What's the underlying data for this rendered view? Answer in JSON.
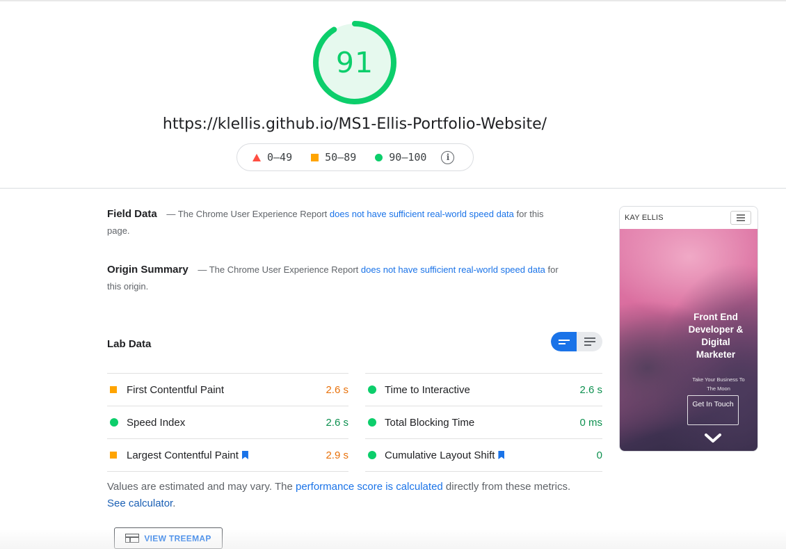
{
  "gauge": {
    "score": "91",
    "score_fraction": 0.91,
    "color": "#0cce6b"
  },
  "url": "https://klellis.github.io/MS1-Ellis-Portfolio-Website/",
  "legend": [
    {
      "icon": "triangle-icon",
      "label": "0–49",
      "color": "#ff4e42"
    },
    {
      "icon": "square-icon",
      "label": "50–89",
      "color": "#ffa400"
    },
    {
      "icon": "circle-icon",
      "label": "90–100",
      "color": "#0cce6b"
    }
  ],
  "field_data": {
    "title": "Field Data",
    "prefix": "— The Chrome User Experience Report",
    "link": "does not have sufficient real-world speed data",
    "suffix": "for this page."
  },
  "origin_summary": {
    "title": "Origin Summary",
    "prefix": "— The Chrome User Experience Report",
    "link": "does not have sufficient real-world speed data",
    "suffix": "for this origin."
  },
  "lab_data": {
    "title": "Lab Data",
    "metrics": [
      {
        "name": "First Contentful Paint",
        "value": "2.6 s",
        "status": "average",
        "bookmark": false
      },
      {
        "name": "Time to Interactive",
        "value": "2.6 s",
        "status": "pass",
        "bookmark": false
      },
      {
        "name": "Speed Index",
        "value": "2.6 s",
        "status": "pass",
        "bookmark": false
      },
      {
        "name": "Total Blocking Time",
        "value": "0 ms",
        "status": "pass",
        "bookmark": false
      },
      {
        "name": "Largest Contentful Paint",
        "value": "2.9 s",
        "status": "average",
        "bookmark": true
      },
      {
        "name": "Cumulative Layout Shift",
        "value": "0",
        "status": "pass",
        "bookmark": true
      }
    ]
  },
  "note": {
    "text1": "Values are estimated and may vary. The",
    "link1": "performance score is calculated",
    "text2": "directly from these metrics.",
    "link2": "See calculator",
    "text3": "."
  },
  "treemap_button": "VIEW TREEMAP",
  "preview": {
    "brand": "KAY ELLIS",
    "hero_title": "Front End Developer & Digital Marketer",
    "hero_sub": "Take Your Business To The Moon",
    "hero_button": "Get In Touch"
  }
}
